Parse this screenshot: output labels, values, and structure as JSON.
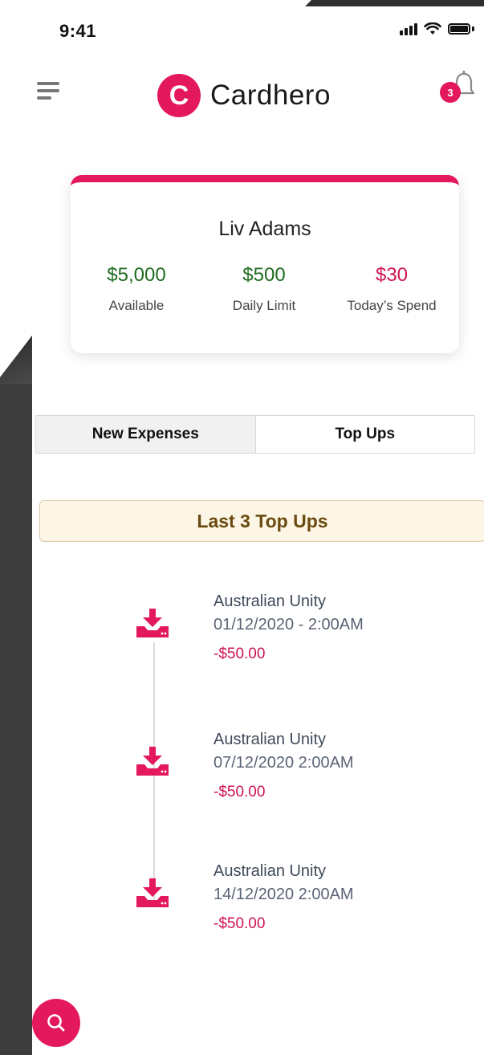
{
  "status_bar": {
    "time": "9:41"
  },
  "header": {
    "brand_name": "Cardhero",
    "brand_initial": "C",
    "notification_count": "3"
  },
  "card": {
    "name": "Liv Adams",
    "stats": [
      {
        "value": "$5,000",
        "label": "Available"
      },
      {
        "value": "$500",
        "label": "Daily Limit"
      },
      {
        "value": "$30",
        "label": "Today’s Spend"
      }
    ]
  },
  "tabs": [
    {
      "label": "New Expenses"
    },
    {
      "label": "Top Ups"
    }
  ],
  "section": {
    "title": "Last 3 Top Ups"
  },
  "transactions": [
    {
      "name": "Australian Unity",
      "date": "01/12/2020 - 2:00AM",
      "amount": "-$50.00"
    },
    {
      "name": "Australian Unity",
      "date": "07/12/2020 2:00AM",
      "amount": "-$50.00"
    },
    {
      "name": "Australian Unity",
      "date": "14/12/2020 2:00AM",
      "amount": "-$50.00"
    }
  ],
  "colors": {
    "accent": "#e4185c",
    "positive": "#1f6b1f",
    "negative": "#d0144f",
    "banner_bg": "#fdf6e6"
  },
  "icons": {
    "menu": "hamburger-icon",
    "notification": "bell-icon",
    "transaction": "download-tray-icon",
    "search": "search-icon"
  }
}
